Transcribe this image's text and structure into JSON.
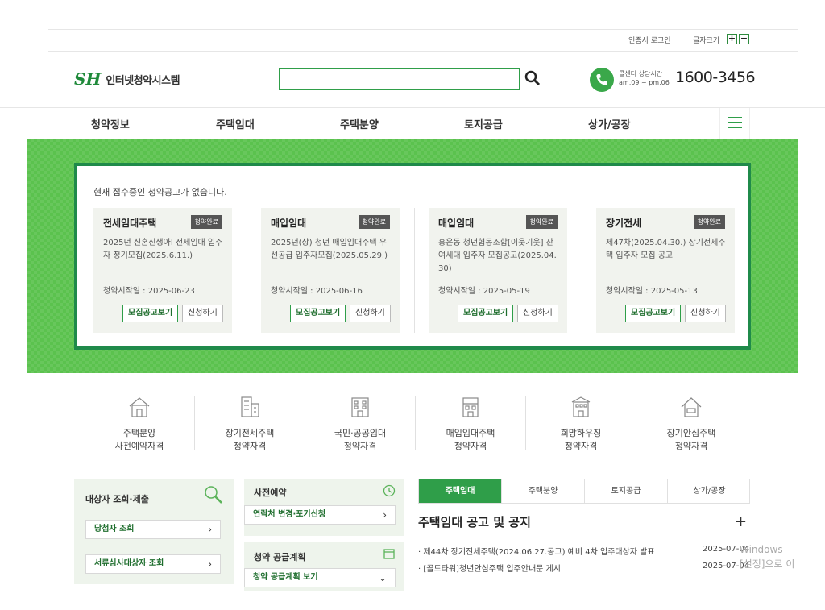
{
  "util": {
    "cert_login": "인증서 로그인",
    "font_size_label": "글자크기",
    "plus": "+",
    "minus": "−"
  },
  "header": {
    "logo_mark": "SH",
    "logo_text": "인터넷청약시스템",
    "search": {
      "value": "",
      "placeholder": ""
    },
    "call_label": "콜센터 상담시간",
    "call_hours": "am,09 ~ pm,06",
    "call_number": "1600-3456"
  },
  "gnb": [
    "청약정보",
    "주택임대",
    "주택분양",
    "토지공급",
    "상가/공장"
  ],
  "banner": {
    "notice": "현재 접수중인 청약공고가 없습니다.",
    "cards": [
      {
        "title": "전세임대주택",
        "badge": "청약완료",
        "desc": "2025년 신혼신생아Ⅰ 전세임대 입주자 정기모집(2025.6.11.)",
        "date": "청약시작일 : 2025-06-23",
        "btn1": "모집공고보기",
        "btn2": "신청하기"
      },
      {
        "title": "매입임대",
        "badge": "청약완료",
        "desc": "2025년(상) 청년 매입임대주택 우선공급 입주자모집(2025.05.29.)",
        "date": "청약시작일 : 2025-06-16",
        "btn1": "모집공고보기",
        "btn2": "신청하기"
      },
      {
        "title": "매입임대",
        "badge": "청약완료",
        "desc": "홍은동 청년협동조합[이웃기웃] 잔여세대 입주자 모집공고(2025.04.30)",
        "date": "청약시작일 : 2025-05-19",
        "btn1": "모집공고보기",
        "btn2": "신청하기"
      },
      {
        "title": "장기전세",
        "badge": "청약완료",
        "desc": "제47차(2025.04.30.) 장기전세주택 입주자 모집 공고",
        "date": "청약시작일 : 2025-05-13",
        "btn1": "모집공고보기",
        "btn2": "신청하기"
      }
    ]
  },
  "quick": [
    {
      "line1": "주택분양",
      "line2": "사전예약자격",
      "icon": "house-icon"
    },
    {
      "line1": "장기전세주택",
      "line2": "청약자격",
      "icon": "building-icon"
    },
    {
      "line1": "국민·공공임대",
      "line2": "청약자격",
      "icon": "apartment-icon"
    },
    {
      "line1": "매입임대주택",
      "line2": "청약자격",
      "icon": "townhouse-icon"
    },
    {
      "line1": "희망하우징",
      "line2": "청약자격",
      "icon": "dormitory-icon"
    },
    {
      "line1": "장기안심주택",
      "line2": "청약자격",
      "icon": "home-safe-icon"
    }
  ],
  "panel_target": {
    "title": "대상자 조회·제출",
    "btn1": "당첨자 조회",
    "btn2": "서류심사대상자 조회"
  },
  "panel_pre": {
    "title": "사전예약",
    "btn": "연락처 변경·포기신청"
  },
  "panel_plan": {
    "title": "청약 공급계획",
    "btn": "청약 공급계획 보기"
  },
  "tabs": [
    "주택임대",
    "주택분양",
    "토지공급",
    "상가/공장"
  ],
  "list": {
    "title": "주택임대 공고 및 공지",
    "more": "+",
    "rows": [
      {
        "text": "· 제44차 장기전세주택(2024.06.27.공고) 예비 4차 입주대상자 발표",
        "date": "2025-07-04"
      },
      {
        "text": "· [골드타워]청년안심주택 입주안내문 게시",
        "date": "2025-07-04"
      }
    ]
  },
  "watermark": {
    "line1": "Windows",
    "line2": "[설정]으로 이"
  },
  "colors": {
    "brand_green": "#2f9e49",
    "banner_green": "#5bc24e",
    "border_dark_green": "#1f8a4a"
  }
}
